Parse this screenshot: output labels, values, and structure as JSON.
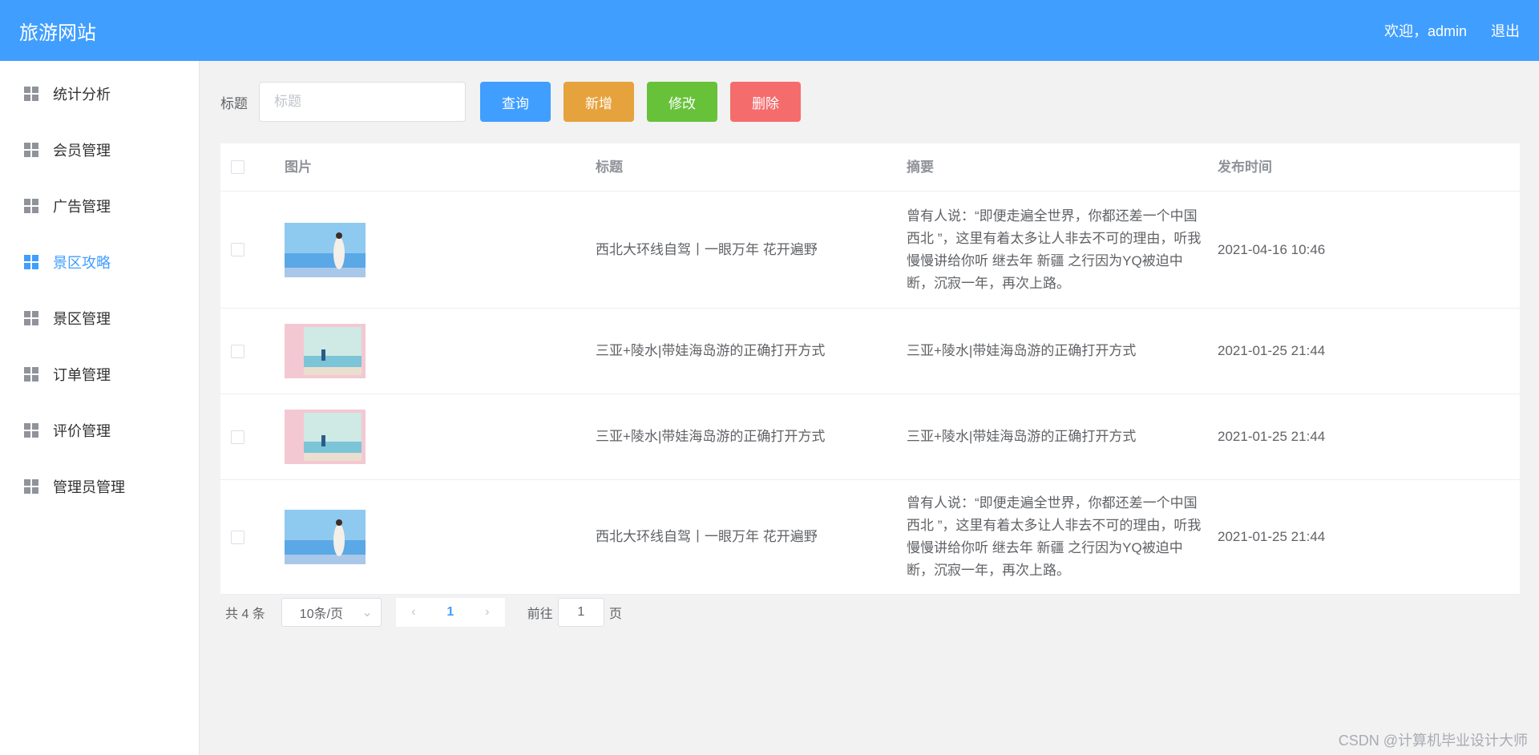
{
  "header": {
    "brand": "旅游网站",
    "welcome": "欢迎，admin",
    "logout": "退出"
  },
  "sidebar": {
    "items": [
      {
        "label": "统计分析",
        "active": false
      },
      {
        "label": "会员管理",
        "active": false
      },
      {
        "label": "广告管理",
        "active": false
      },
      {
        "label": "景区攻略",
        "active": true
      },
      {
        "label": "景区管理",
        "active": false
      },
      {
        "label": "订单管理",
        "active": false
      },
      {
        "label": "评价管理",
        "active": false
      },
      {
        "label": "管理员管理",
        "active": false
      }
    ]
  },
  "toolbar": {
    "title_label": "标题",
    "title_placeholder": "标题",
    "query": "查询",
    "add": "新增",
    "edit": "修改",
    "delete": "删除"
  },
  "table": {
    "columns": [
      "图片",
      "标题",
      "摘要",
      "发布时间"
    ],
    "rows": [
      {
        "image": "beach-photo",
        "title": "西北大环线自驾丨一眼万年 花开遍野",
        "summary": "曾有人说：“即便走遍全世界，你都还差一个中国 西北 ”，这里有着太多让人非去不可的理由，听我慢慢讲给你听 继去年 新疆 之行因为YQ被迫中断，沉寂一年，再次上路。",
        "time": "2021-04-16 10:46"
      },
      {
        "image": "sanya-photo",
        "title": "三亚+陵水|带娃海岛游的正确打开方式",
        "summary": "三亚+陵水|带娃海岛游的正确打开方式",
        "time": "2021-01-25 21:44"
      },
      {
        "image": "sanya-photo",
        "title": "三亚+陵水|带娃海岛游的正确打开方式",
        "summary": "三亚+陵水|带娃海岛游的正确打开方式",
        "time": "2021-01-25 21:44"
      },
      {
        "image": "beach-photo",
        "title": "西北大环线自驾丨一眼万年 花开遍野",
        "summary": "曾有人说：“即便走遍全世界，你都还差一个中国 西北 ”，这里有着太多让人非去不可的理由，听我慢慢讲给你听 继去年 新疆 之行因为YQ被迫中断，沉寂一年，再次上路。",
        "time": "2021-01-25 21:44"
      }
    ]
  },
  "pagination": {
    "total": "共 4 条",
    "page_size": "10条/页",
    "current_page": "1",
    "goto_label": "前往",
    "goto_value": "1",
    "page_suffix": "页"
  },
  "watermark": "CSDN @计算机毕业设计大师",
  "colors": {
    "primary": "#409eff",
    "warning": "#e6a23c",
    "success": "#67c23a",
    "danger": "#f56c6c"
  }
}
